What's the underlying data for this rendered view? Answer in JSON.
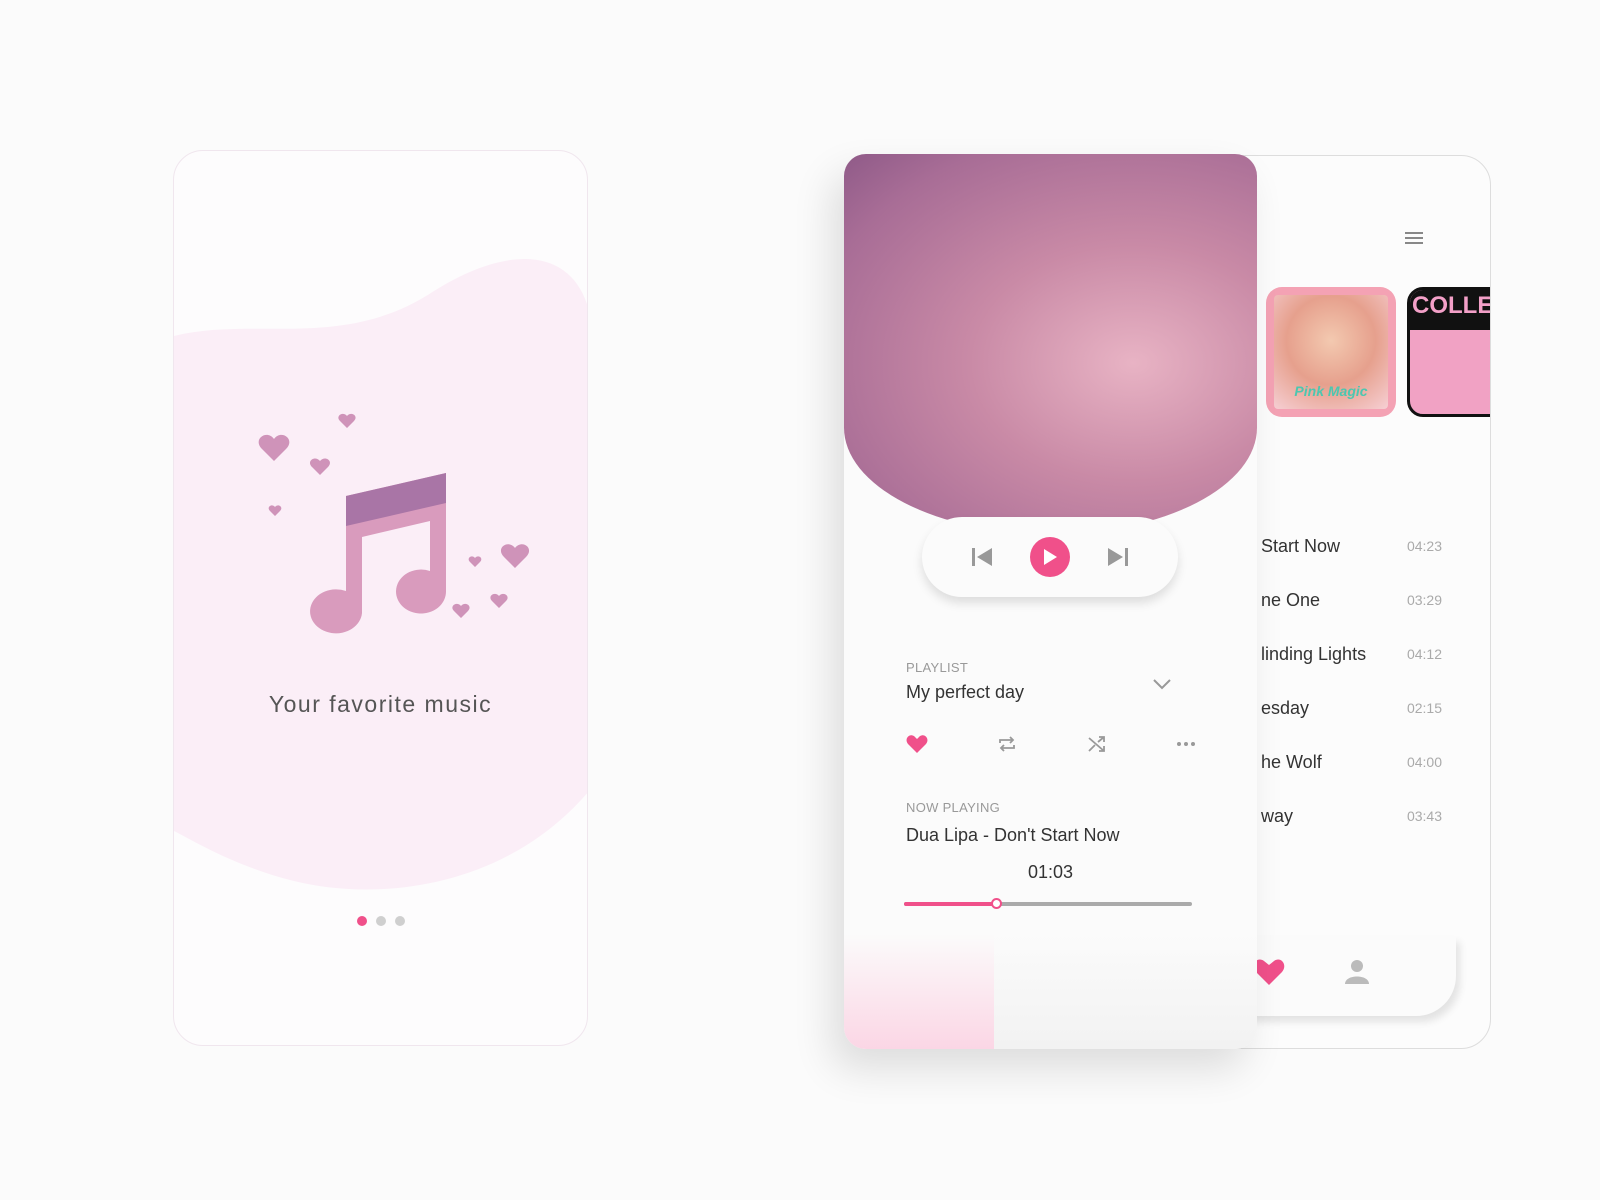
{
  "onboarding": {
    "tagline": "Your favorite music",
    "pages": 3,
    "active_page": 1
  },
  "player": {
    "playlist_label": "PLAYLIST",
    "playlist_name": "My perfect day",
    "now_playing_label": "NOW PLAYING",
    "track": "Dua Lipa - Don't Start Now",
    "elapsed": "01:03",
    "progress": 0.32,
    "liked": true,
    "accent": "#f0508a"
  },
  "library": {
    "albums": [
      {
        "title": "Pink Magic"
      },
      {
        "title": "COLLE"
      }
    ],
    "songs": [
      {
        "title": "Start Now",
        "duration": "04:23"
      },
      {
        "title": "ne One",
        "duration": "03:29"
      },
      {
        "title": "linding Lights",
        "duration": "04:12"
      },
      {
        "title": "esday",
        "duration": "02:15"
      },
      {
        "title": "he Wolf",
        "duration": "04:00"
      },
      {
        "title": "way",
        "duration": "03:43"
      }
    ]
  }
}
